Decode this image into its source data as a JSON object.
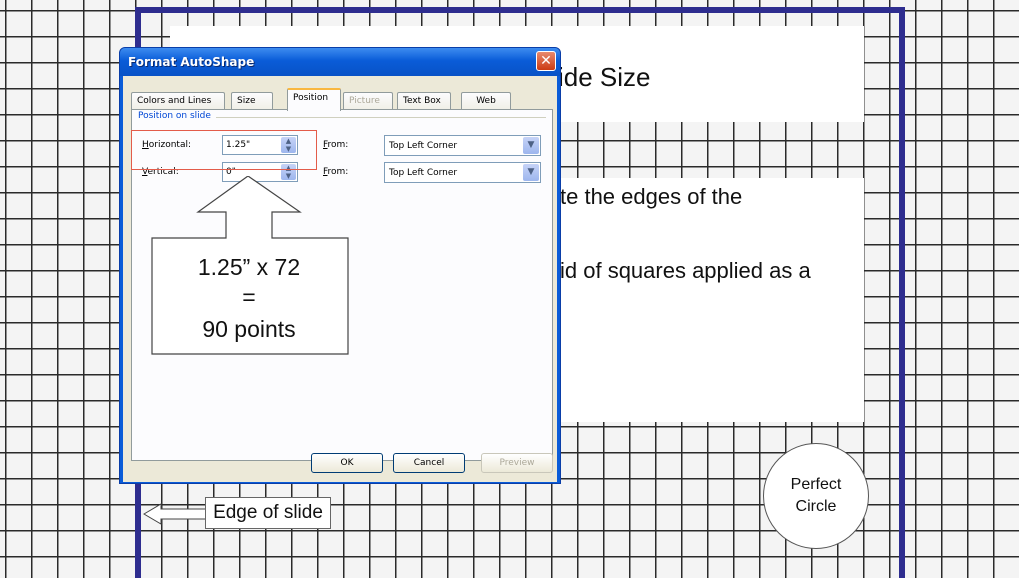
{
  "slide": {
    "title_fragment": "ide Size",
    "body_line1": "te the edges of the",
    "body_line2": "id of squares applied as a"
  },
  "dialog": {
    "title": "Format AutoShape",
    "close_glyph": "✕",
    "tabs": [
      "Colors and Lines",
      "Size",
      "Position",
      "Picture",
      "Text Box",
      "Web"
    ],
    "active_tab": "Position",
    "disabled_tabs": [
      "Picture"
    ],
    "group_label": "Position on slide",
    "horizontal": {
      "label_prefix": "H",
      "label_rest": "orizontal:",
      "value": "1.25\"",
      "from_label_prefix": "F",
      "from_label_rest": "rom:",
      "from_value": "Top Left Corner"
    },
    "vertical": {
      "label_prefix": "V",
      "label_rest": "ertical:",
      "value": "0\"",
      "from_label_prefix": "F",
      "from_label_rest": "rom:",
      "from_value": "Top Left Corner"
    },
    "buttons": {
      "ok": "OK",
      "cancel": "Cancel",
      "preview": "Preview"
    }
  },
  "callout": {
    "line1": "1.25” x 72",
    "line2": "=",
    "line3": "90 points"
  },
  "edge_label": "Edge of slide",
  "circle": {
    "line1": "Perfect",
    "line2": "Circle"
  },
  "colors": {
    "slide_border": "#2e2d8f",
    "title_bar": "#0a5cd8",
    "highlight": "#e35c4a"
  }
}
